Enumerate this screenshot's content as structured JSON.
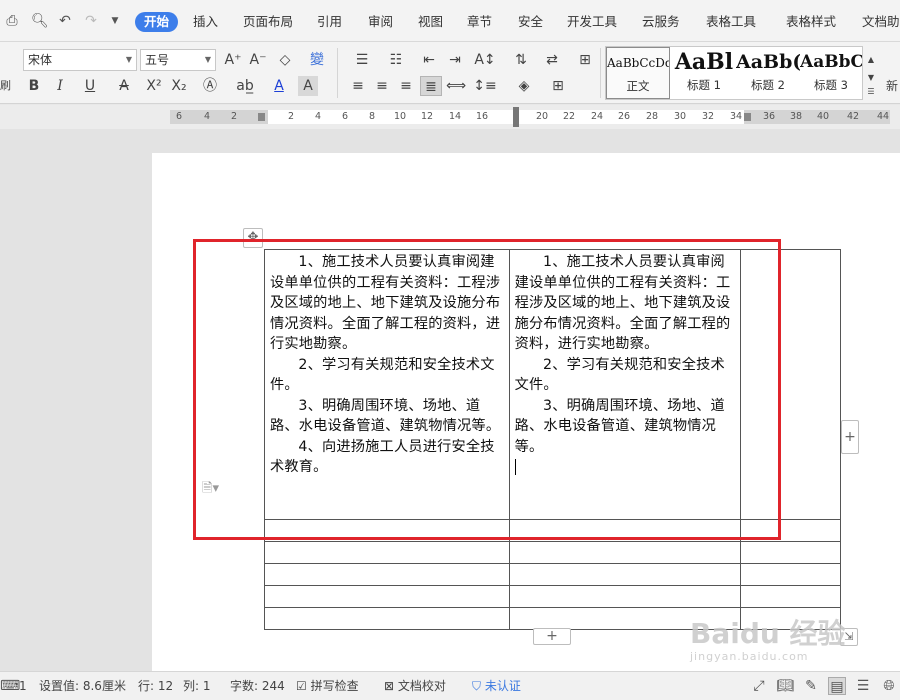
{
  "menu": {
    "tabs": [
      "开始",
      "插入",
      "页面布局",
      "引用",
      "审阅",
      "视图",
      "章节",
      "安全",
      "开发工具",
      "云服务",
      "表格工具",
      "表格样式",
      "文档助"
    ],
    "active_tab": "开始"
  },
  "ribbon": {
    "font_name": "宋体",
    "font_size": "五号",
    "styles": [
      {
        "sample": "AaBbCcDd",
        "name": "正文"
      },
      {
        "sample": "AaBl",
        "name": "标题 1"
      },
      {
        "sample": "AaBb(",
        "name": "标题 2"
      },
      {
        "sample": "AaBbC",
        "name": "标题 3"
      }
    ],
    "new_style_label": "新",
    "left_edge_label": "刷"
  },
  "ruler": {
    "ticks_left": [
      "6",
      "4",
      "2"
    ],
    "ticks_mid": [
      "2",
      "4",
      "6",
      "8",
      "10",
      "12",
      "14",
      "16",
      "20",
      "22",
      "24",
      "26",
      "28",
      "30",
      "32",
      "34"
    ],
    "ticks_right": [
      "36",
      "38",
      "40",
      "42",
      "44"
    ]
  },
  "table": {
    "cell1": [
      "1、施工技术人员要认真审阅建设单单位供的工程有关资料：工程涉及区域的地上、地下建筑及设施分布情况资料。全面了解工程的资料，进行实地勘察。",
      "2、学习有关规范和安全技术文件。",
      "3、明确周围环境、场地、道路、水电设备管道、建筑物情况等。",
      "4、向进扬施工人员进行安全技术教育。"
    ],
    "cell2": [
      "1、施工技术人员要认真审阅建设单单位供的工程有关资料：工程涉及区域的地上、地下建筑及设施分布情况资料。全面了解工程的资料，进行实地勘察。",
      "2、学习有关规范和安全技术文件。",
      "3、明确周围环境、场地、道路、水电设备管道、建筑物情况等。"
    ]
  },
  "status": {
    "page_num": "1",
    "setting_value": "设置值: 8.6厘米",
    "row": "行: 12",
    "col": "列: 1",
    "word_count": "字数: 244",
    "spell_check": "拼写检查",
    "doc_proof": "文档校对",
    "unverified": "未认证"
  },
  "watermark": {
    "brand": "Baidu 经验",
    "url": "jingyan.baidu.com"
  },
  "colors": {
    "active_tab": "#3d7eea",
    "highlight": "#e0242b",
    "unverified": "#3a78e0"
  }
}
